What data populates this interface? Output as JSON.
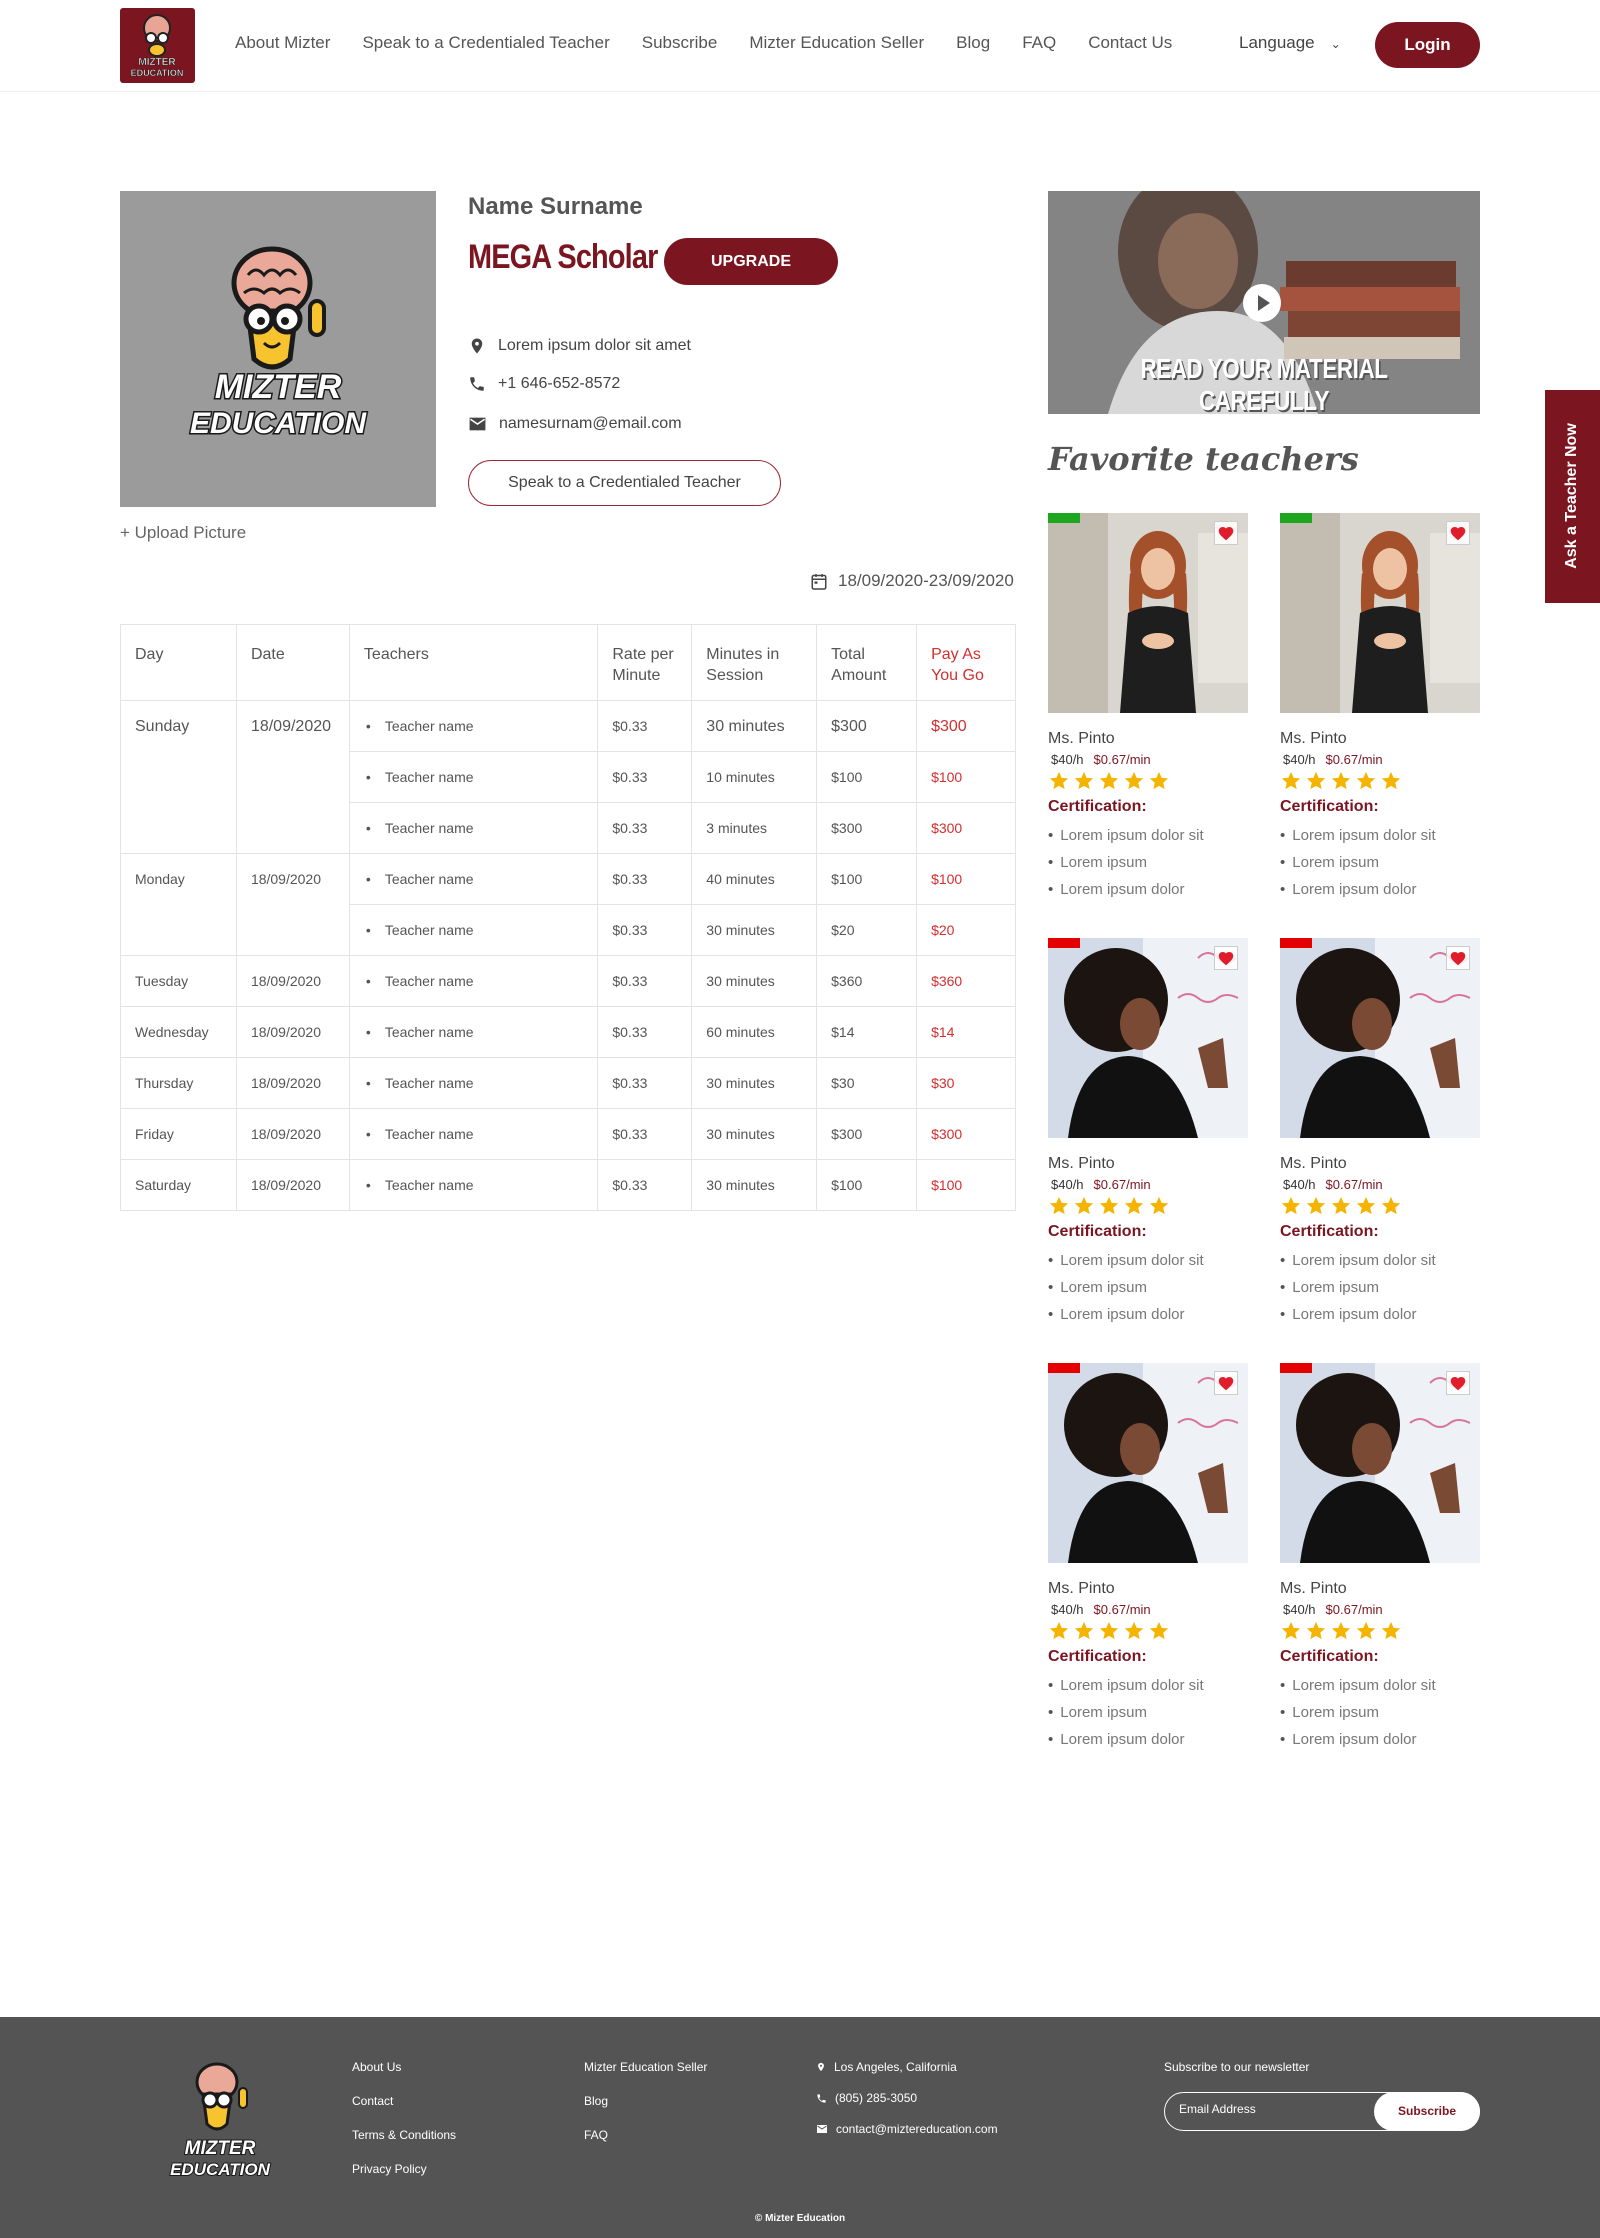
{
  "nav": {
    "items": [
      "About Mizter",
      "Speak to a Credentialed Teacher",
      "Subscribe",
      "Mizter Education Seller",
      "Blog",
      "FAQ",
      "Contact Us"
    ],
    "language": "Language",
    "login": "Login"
  },
  "logo": {
    "line1": "MIZTER",
    "line2": "EDUCATION"
  },
  "profile": {
    "name": "Name Surname",
    "plan": "MEGA Scholar",
    "upgrade": "UPGRADE",
    "address": "Lorem ipsum dolor sit amet",
    "phone": "+1 646-652-8572",
    "email": "namesurnam@email.com",
    "speak_button": "Speak to a Credentialed Teacher",
    "upload": "+ Upload Picture",
    "date_range": "18/09/2020-23/09/2020"
  },
  "table": {
    "headers": [
      "Day",
      "Date",
      "Teachers",
      "Rate per Minute",
      "Minutes in Session",
      "Total Amount",
      "Pay As You Go"
    ],
    "rows": [
      {
        "day": "Sunday",
        "date": "18/09/2020",
        "teacher": "Teacher name",
        "rate": "$0.33",
        "minutes": "30 minutes",
        "total": "$300",
        "payg": "$300"
      },
      {
        "day": "",
        "date": "",
        "teacher": "Teacher name",
        "rate": "$0.33",
        "minutes": "10 minutes",
        "total": "$100",
        "payg": "$100"
      },
      {
        "day": "",
        "date": "",
        "teacher": "Teacher name",
        "rate": "$0.33",
        "minutes": "3 minutes",
        "total": "$300",
        "payg": "$300"
      },
      {
        "day": "Monday",
        "date": "18/09/2020",
        "teacher": "Teacher name",
        "rate": "$0.33",
        "minutes": "40 minutes",
        "total": "$100",
        "payg": "$100"
      },
      {
        "day": "",
        "date": "",
        "teacher": "Teacher name",
        "rate": "$0.33",
        "minutes": "30 minutes",
        "total": "$20",
        "payg": "$20"
      },
      {
        "day": "Tuesday",
        "date": "18/09/2020",
        "teacher": "Teacher name",
        "rate": "$0.33",
        "minutes": "30 minutes",
        "total": "$360",
        "payg": "$360"
      },
      {
        "day": "Wednesday",
        "date": "18/09/2020",
        "teacher": "Teacher name",
        "rate": "$0.33",
        "minutes": "60 minutes",
        "total": "$14",
        "payg": "$14"
      },
      {
        "day": "Thursday",
        "date": "18/09/2020",
        "teacher": "Teacher name",
        "rate": "$0.33",
        "minutes": "30 minutes",
        "total": "$30",
        "payg": "$30"
      },
      {
        "day": "Friday",
        "date": "18/09/2020",
        "teacher": "Teacher name",
        "rate": "$0.33",
        "minutes": "30 minutes",
        "total": "$300",
        "payg": "$300"
      },
      {
        "day": "Saturday",
        "date": "18/09/2020",
        "teacher": "Teacher name",
        "rate": "$0.33",
        "minutes": "30 minutes",
        "total": "$100",
        "payg": "$100"
      }
    ]
  },
  "video": {
    "caption": "READ YOUR MATERIAL CAREFULLY"
  },
  "favorites": {
    "title": "Favorite teachers",
    "cards": [
      {
        "name": "Ms. Pinto",
        "rate_hour": "$40/h",
        "rate_min": "$0.67/min",
        "rating": 5,
        "status_color": "#1fa61f",
        "photo": "redhead",
        "cert_label": "Certification:",
        "certs": [
          "Lorem ipsum dolor sit",
          "Lorem ipsum",
          "Lorem ipsum dolor"
        ]
      },
      {
        "name": "Ms. Pinto",
        "rate_hour": "$40/h",
        "rate_min": "$0.67/min",
        "rating": 5,
        "status_color": "#1fa61f",
        "photo": "redhead",
        "cert_label": "Certification:",
        "certs": [
          "Lorem ipsum dolor sit",
          "Lorem ipsum",
          "Lorem ipsum dolor"
        ]
      },
      {
        "name": "Ms. Pinto",
        "rate_hour": "$40/h",
        "rate_min": "$0.67/min",
        "rating": 5,
        "status_color": "#e50000",
        "photo": "curly",
        "cert_label": "Certification:",
        "certs": [
          "Lorem ipsum dolor sit",
          "Lorem ipsum",
          "Lorem ipsum dolor"
        ]
      },
      {
        "name": "Ms. Pinto",
        "rate_hour": "$40/h",
        "rate_min": "$0.67/min",
        "rating": 5,
        "status_color": "#e50000",
        "photo": "curly",
        "cert_label": "Certification:",
        "certs": [
          "Lorem ipsum dolor sit",
          "Lorem ipsum",
          "Lorem ipsum dolor"
        ]
      },
      {
        "name": "Ms. Pinto",
        "rate_hour": "$40/h",
        "rate_min": "$0.67/min",
        "rating": 5,
        "status_color": "#e50000",
        "photo": "curly",
        "cert_label": "Certification:",
        "certs": [
          "Lorem ipsum dolor sit",
          "Lorem ipsum",
          "Lorem ipsum dolor"
        ]
      },
      {
        "name": "Ms. Pinto",
        "rate_hour": "$40/h",
        "rate_min": "$0.67/min",
        "rating": 5,
        "status_color": "#e50000",
        "photo": "curly",
        "cert_label": "Certification:",
        "certs": [
          "Lorem ipsum dolor sit",
          "Lorem ipsum",
          "Lorem ipsum dolor"
        ]
      }
    ]
  },
  "sidetab": "Ask a Teacher Now",
  "footer": {
    "col1": [
      "About Us",
      "Contact",
      "Terms & Conditions",
      "Privacy Policy"
    ],
    "col2": [
      "Mizter Education Seller",
      "Blog",
      "FAQ"
    ],
    "location": "Los Angeles, California",
    "phone": "(805) 285-3050",
    "email": "contact@miztereducation.com",
    "newsletter_label": "Subscribe to our newsletter",
    "newsletter_placeholder": "Email Address",
    "subscribe": "Subscribe",
    "copyright": "© Mizter Education"
  },
  "colors": {
    "brand": "#7b1520",
    "pay_red": "#d32f2f",
    "star": "#f5b400",
    "online": "#1fa61f",
    "offline": "#e50000"
  }
}
